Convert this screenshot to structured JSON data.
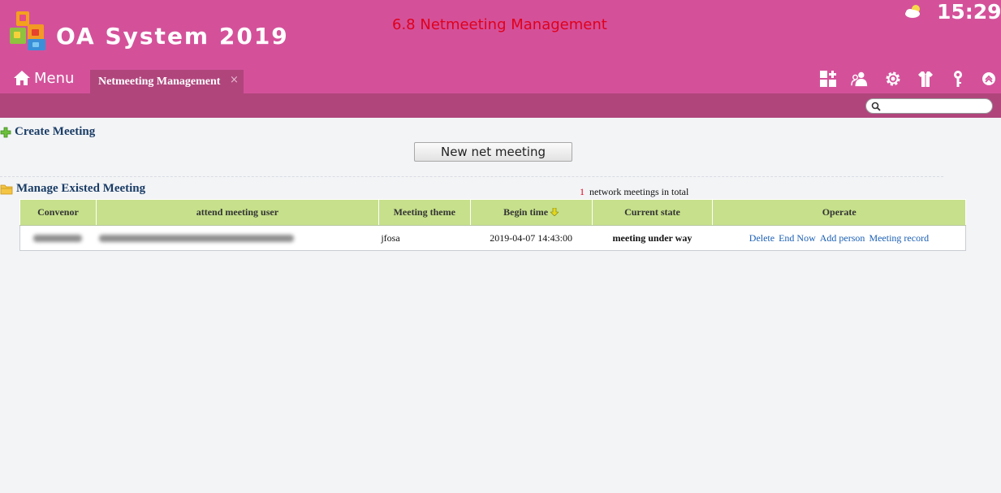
{
  "header": {
    "app_title": "OA System 2019",
    "page_caption": "6.8 Netmeeting Management",
    "clock": "15:29",
    "weather_icon": "weather-cloud-sun-icon",
    "menu_label": "Menu",
    "active_tab": {
      "label": "Netmeeting Management",
      "close": "×"
    },
    "toolbar_icons": [
      "apps-icon",
      "users-icon",
      "gear-icon",
      "shirt-icon",
      "key-icon",
      "collapse-up-icon"
    ],
    "search": {
      "placeholder": ""
    }
  },
  "create_section": {
    "title": "Create Meeting",
    "new_button": "New net meeting"
  },
  "manage_section": {
    "title": "Manage Existed Meeting",
    "total_count": "1",
    "total_text": "network meetings in total"
  },
  "table": {
    "columns": [
      "Convenor",
      "attend meeting user",
      "Meeting theme",
      "Begin time",
      "Current state",
      "Operate"
    ],
    "rows": [
      {
        "theme": "jfosa",
        "begin_time": "2019-04-07 14:43:00",
        "state": "meeting under way",
        "actions": [
          "Delete",
          "End Now",
          "Add person",
          "Meeting record"
        ]
      }
    ]
  },
  "colors": {
    "header_bg": "#d4519a",
    "subbar_bg": "#b0457c",
    "caption_red": "#e0001b",
    "table_header_bg": "#c6e08b",
    "state_green": "#1fa63a",
    "link_blue": "#1a5fb4",
    "section_title": "#1a3d66"
  }
}
